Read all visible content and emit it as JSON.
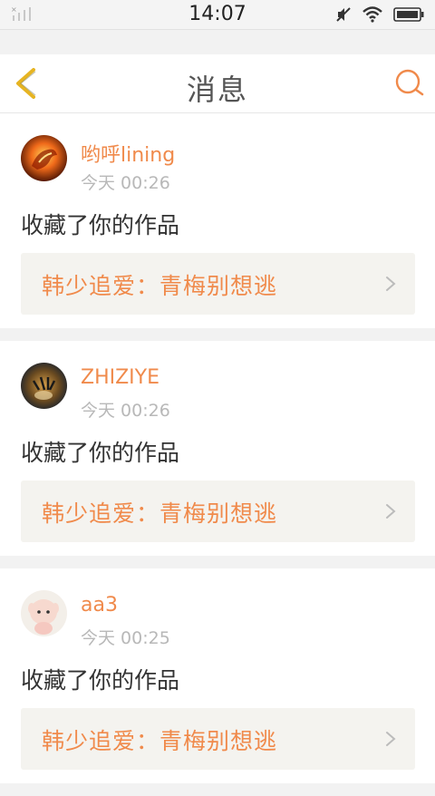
{
  "status_bar": {
    "time": "14:07",
    "icons": [
      "signal-icon",
      "mute-icon",
      "wifi-icon",
      "battery-icon"
    ]
  },
  "header": {
    "title": "消息",
    "back_icon": "back-chevron-icon",
    "search_icon": "search-icon",
    "accent_color": "#f08a4b",
    "back_color": "#e6b422"
  },
  "messages": [
    {
      "username": "哟呼lining",
      "time": "今天 00:26",
      "action": "收藏了你的作品",
      "work_title": "韩少追爱：青梅别想逃",
      "avatar_icon": "fire-horse-avatar"
    },
    {
      "username": "ZHIZIYE",
      "time": "今天 00:26",
      "action": "收藏了你的作品",
      "work_title": "韩少追爱：青梅别想逃",
      "avatar_icon": "tiger-avatar"
    },
    {
      "username": "aa3",
      "time": "今天 00:25",
      "action": "收藏了你的作品",
      "work_title": "韩少追爱：青梅别想逃",
      "avatar_icon": "doll-avatar"
    }
  ]
}
